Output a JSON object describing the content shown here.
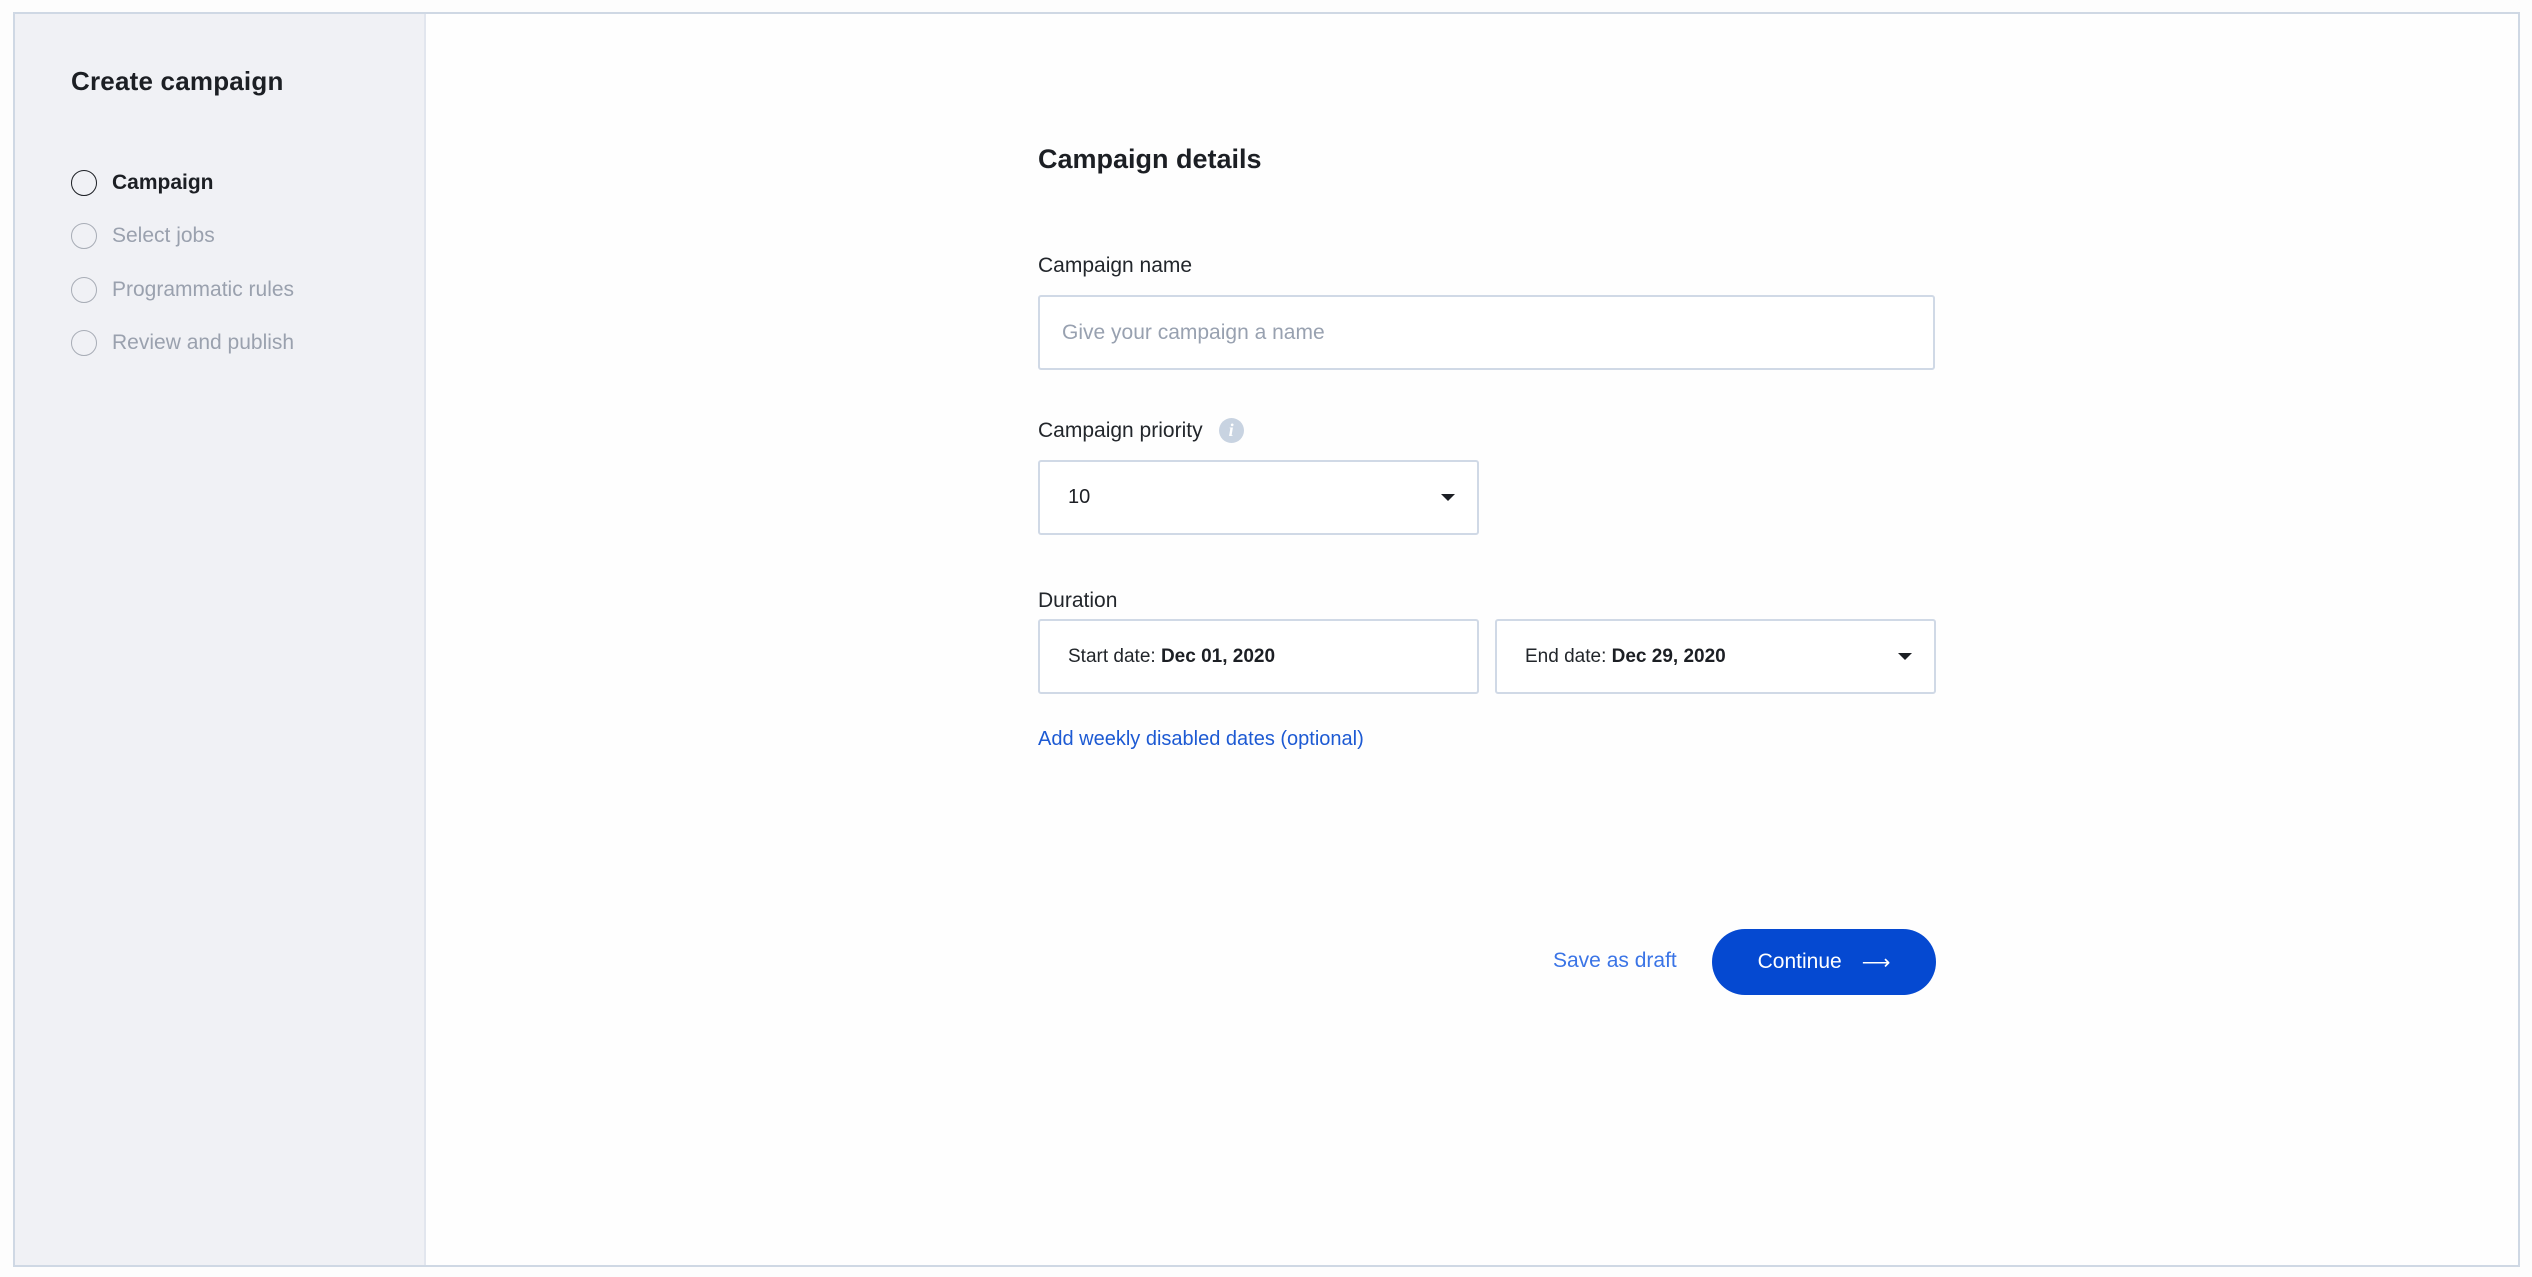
{
  "sidebar": {
    "title": "Create campaign",
    "steps": [
      {
        "label": "Campaign",
        "state": "active"
      },
      {
        "label": "Select jobs",
        "state": "pending"
      },
      {
        "label": "Programmatic rules",
        "state": "pending"
      },
      {
        "label": "Review and publish",
        "state": "pending"
      }
    ]
  },
  "main": {
    "section_title": "Campaign details",
    "campaign_name": {
      "label": "Campaign name",
      "value": "",
      "placeholder": "Give your campaign a name"
    },
    "campaign_priority": {
      "label": "Campaign priority",
      "info_icon": "info-icon",
      "selected": "10"
    },
    "duration": {
      "label": "Duration",
      "start_prefix": "Start date: ",
      "start_value": "Dec 01, 2020",
      "end_prefix": "End date: ",
      "end_value": "Dec 29, 2020"
    },
    "weekly_disabled_link": "Add weekly disabled dates (optional)",
    "save_draft_label": "Save as draft",
    "continue_label": "Continue",
    "continue_icon": "arrow-right-icon",
    "colors": {
      "primary": "#0549d1",
      "link": "#1d5ad3",
      "sidebar_bg": "#f0f1f5"
    }
  }
}
